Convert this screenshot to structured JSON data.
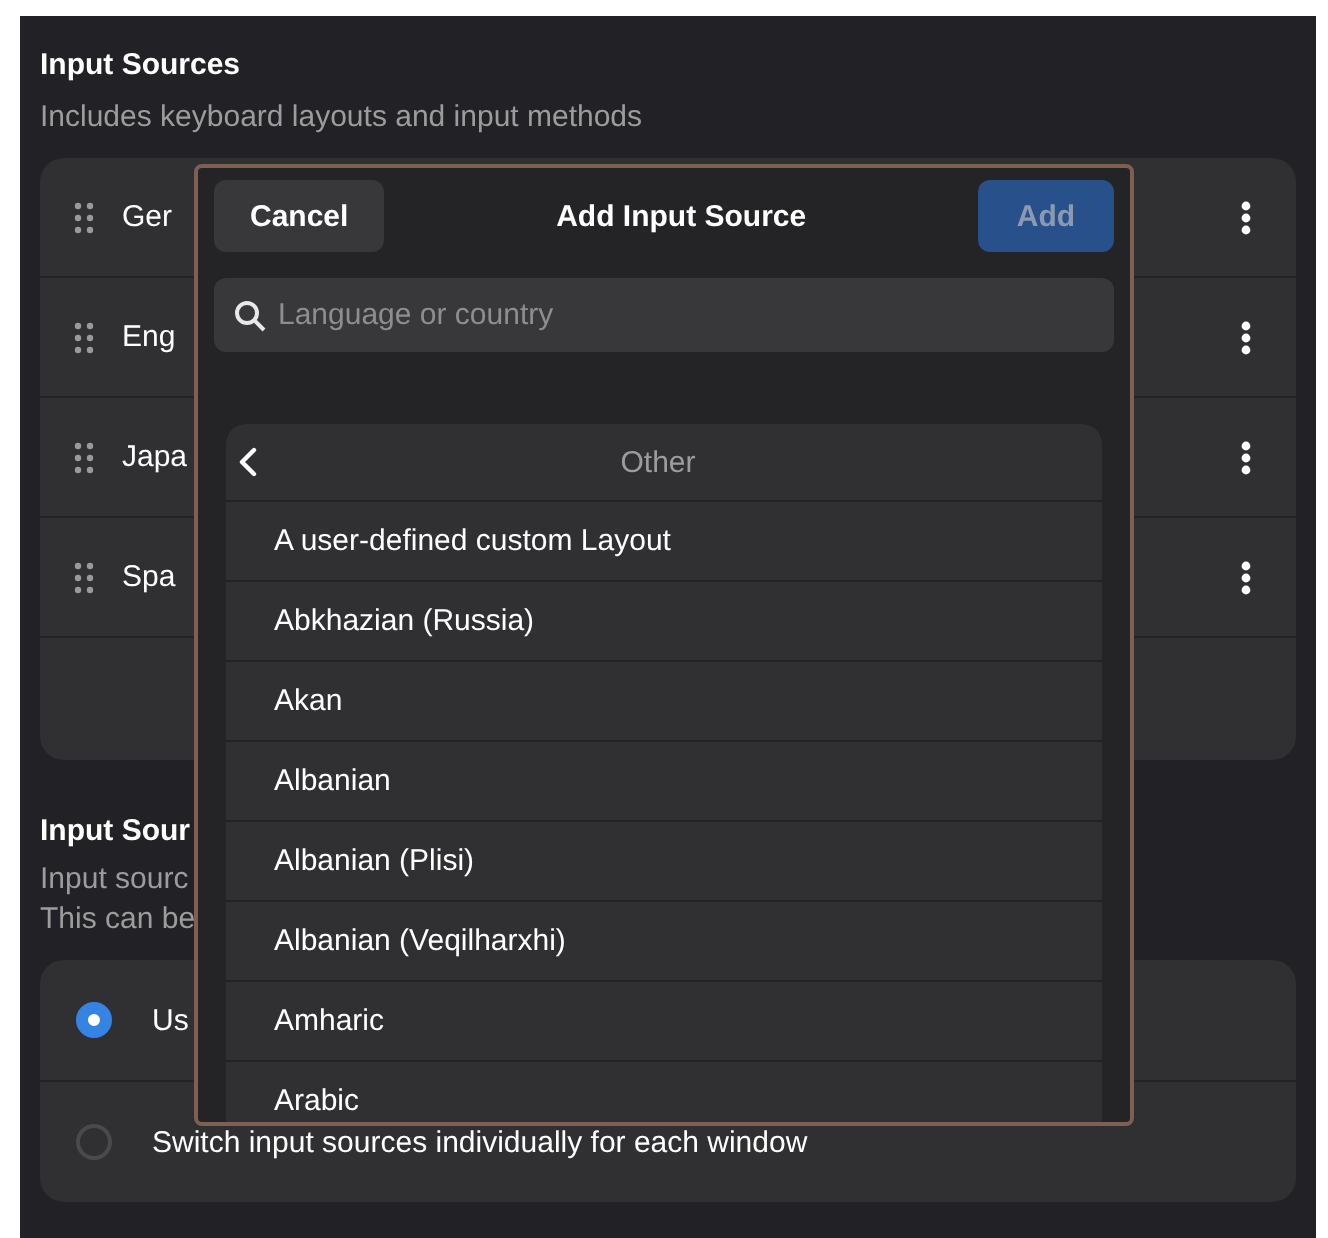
{
  "input_sources": {
    "title": "Input Sources",
    "subtitle": "Includes keyboard layouts and input methods",
    "rows": [
      {
        "label": "Ger"
      },
      {
        "label": "Eng"
      },
      {
        "label": "Japa"
      },
      {
        "label": "Spa"
      }
    ]
  },
  "switching": {
    "title": "Input Sour",
    "description": [
      "Input sourc",
      "This can be"
    ],
    "options": [
      {
        "label": "Us",
        "selected": true
      },
      {
        "label": "Switch input sources individually for each window",
        "selected": false
      }
    ]
  },
  "dialog": {
    "title": "Add Input Source",
    "cancel": "Cancel",
    "add": {
      "label": "Add",
      "disabled": true
    },
    "search": {
      "placeholder": "Language or country"
    },
    "list": {
      "header": "Other",
      "items": [
        "A user-defined custom Layout",
        "Abkhazian (Russia)",
        "Akan",
        "Albanian",
        "Albanian (Plisi)",
        "Albanian (Veqilharxhi)",
        "Amharic",
        "Arabic"
      ]
    }
  }
}
